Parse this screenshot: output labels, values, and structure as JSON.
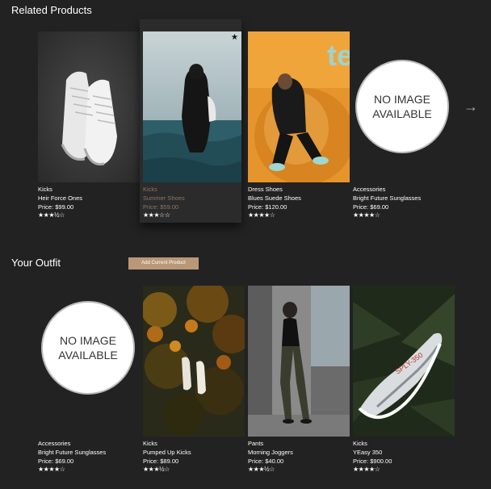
{
  "related": {
    "title": "Related Products",
    "next_arrow": "→",
    "items": [
      {
        "category": "Kicks",
        "name": "Heir Force Ones",
        "price": "Price: $99.00",
        "rating": 3.5,
        "stars": "★★★½☆",
        "image": "white sneakers photo"
      },
      {
        "category": "Kicks",
        "name": "Summer Shoes",
        "price": "Price: $59.00",
        "rating": 3,
        "stars": "★★★☆☆",
        "image": "person in ocean photo",
        "favorited": true
      },
      {
        "category": "Dress Shoes",
        "name": "Blues Suede Shoes",
        "price": "Price: $120.00",
        "rating": 4,
        "stars": "★★★★☆",
        "image": "person on orange beanbag photo"
      },
      {
        "category": "Accessories",
        "name": "Bright Future Sunglasses",
        "price": "Price: $69.00",
        "rating": 4,
        "stars": "★★★★☆",
        "image": "no image",
        "no_image_text": [
          "NO IMAGE",
          "AVAILABLE"
        ]
      }
    ]
  },
  "outfit": {
    "title": "Your Outfit",
    "add_button": "Add Current Product",
    "items": [
      {
        "category": "Accessories",
        "name": "Bright Future Sunglasses",
        "price": "Price: $69.00",
        "rating": 4,
        "stars": "★★★★☆",
        "image": "no image",
        "no_image_text": [
          "NO IMAGE",
          "AVAILABLE"
        ]
      },
      {
        "category": "Kicks",
        "name": "Pumped Up Kicks",
        "price": "Price: $89.00",
        "rating": 3.5,
        "stars": "★★★½☆",
        "image": "sneakers in autumn leaves photo"
      },
      {
        "category": "Pants",
        "name": "Morning Joggers",
        "price": "Price: $40.00",
        "rating": 3.5,
        "stars": "★★★½☆",
        "image": "person in joggers photo"
      },
      {
        "category": "Kicks",
        "name": "YEasy 350",
        "price": "Price: $900.00",
        "rating": 4,
        "stars": "★★★★☆",
        "image": "grey sneaker in ferns photo"
      }
    ]
  }
}
